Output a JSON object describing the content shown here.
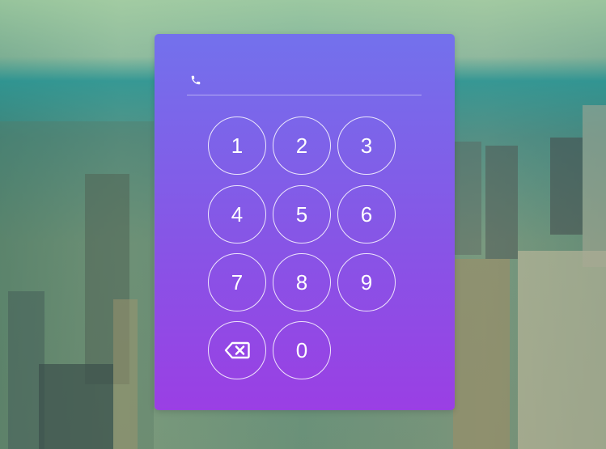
{
  "phone_input": {
    "value": "",
    "placeholder": ""
  },
  "keypad": {
    "keys": [
      "1",
      "2",
      "3",
      "4",
      "5",
      "6",
      "7",
      "8",
      "9",
      "0"
    ],
    "backspace_icon": "backspace-icon"
  },
  "icons": {
    "phone": "phone-icon"
  },
  "colors": {
    "card_top": "#7371ec",
    "card_bottom": "#9a3fe4",
    "key_border": "#ffffff"
  }
}
